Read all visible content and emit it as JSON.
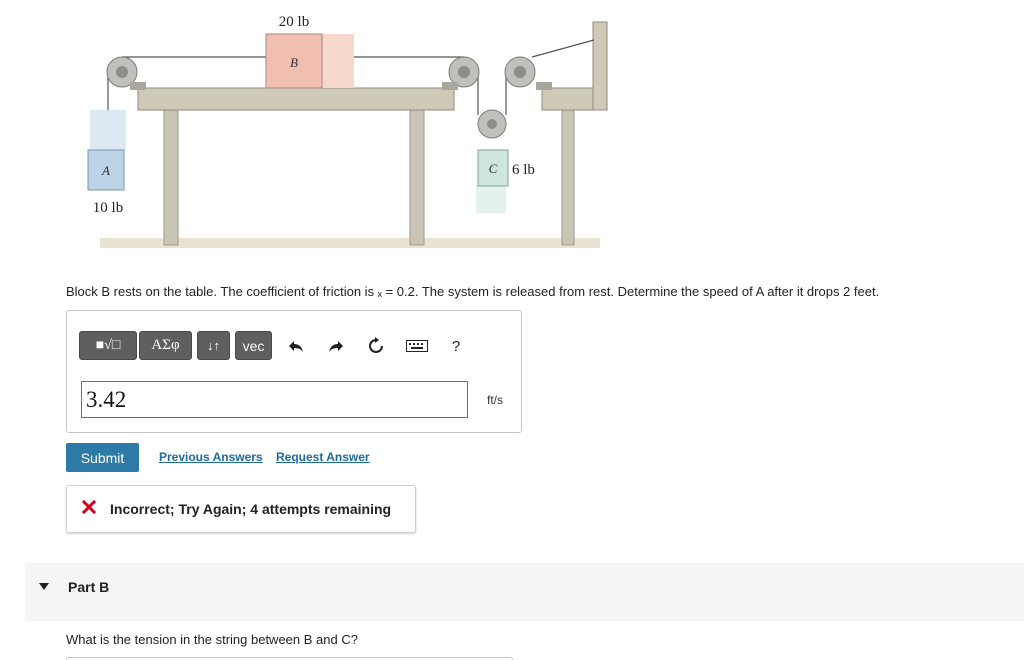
{
  "figure": {
    "block_b": {
      "letter": "B",
      "weight": "20 lb"
    },
    "block_a": {
      "letter": "A",
      "weight": "10 lb"
    },
    "block_c": {
      "letter": "C",
      "weight": "6 lb"
    }
  },
  "problem": {
    "text": "Block B rests on the table. The coefficient of friction is ₓ = 0.2. The system is released from rest.  Determine the speed of A after it drops 2 feet."
  },
  "toolbar": {
    "template_label": "■√□",
    "greek_label": "ΑΣφ",
    "arrows_label": "↓↑",
    "vec_label": "vec",
    "undo_icon": "undo-icon",
    "redo_icon": "redo-icon",
    "reset_icon": "reset-icon",
    "keyboard_icon": "keyboard-icon",
    "help_label": "?"
  },
  "answer": {
    "value": "3.42",
    "unit": "ft/s"
  },
  "actions": {
    "submit_label": "Submit",
    "previous_answers": "Previous Answers",
    "request_answer": "Request Answer"
  },
  "feedback": {
    "icon": "x-mark-icon",
    "text": "Incorrect; Try Again; 4 attempts remaining",
    "color": "#d0021b"
  },
  "part_b": {
    "title": "Part B",
    "question": "What is the tension in the string between B and C?"
  },
  "colors": {
    "submit": "#2e7aa6",
    "link": "#1c6aa0",
    "toolbar_button": "#5f5f5f"
  }
}
